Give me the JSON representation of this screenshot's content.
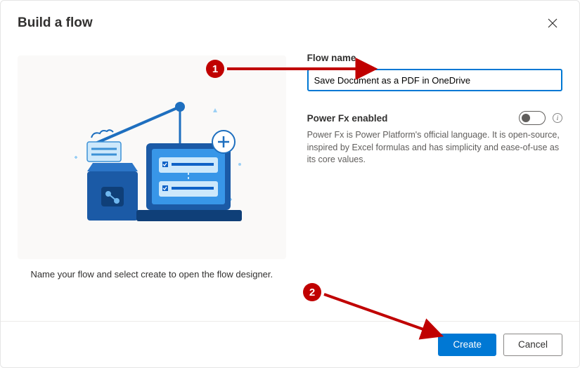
{
  "dialog": {
    "title": "Build a flow",
    "caption": "Name your flow and select create to open the flow designer."
  },
  "form": {
    "flow_name_label": "Flow name",
    "flow_name_value": "Save Document as a PDF in OneDrive",
    "powerfx_label": "Power Fx enabled",
    "powerfx_desc": "Power Fx is Power Platform's official language. It is open-source, inspired by Excel formulas and has simplicity and ease-of-use as its core values."
  },
  "buttons": {
    "create": "Create",
    "cancel": "Cancel"
  },
  "annotations": {
    "m1": "1",
    "m2": "2"
  }
}
